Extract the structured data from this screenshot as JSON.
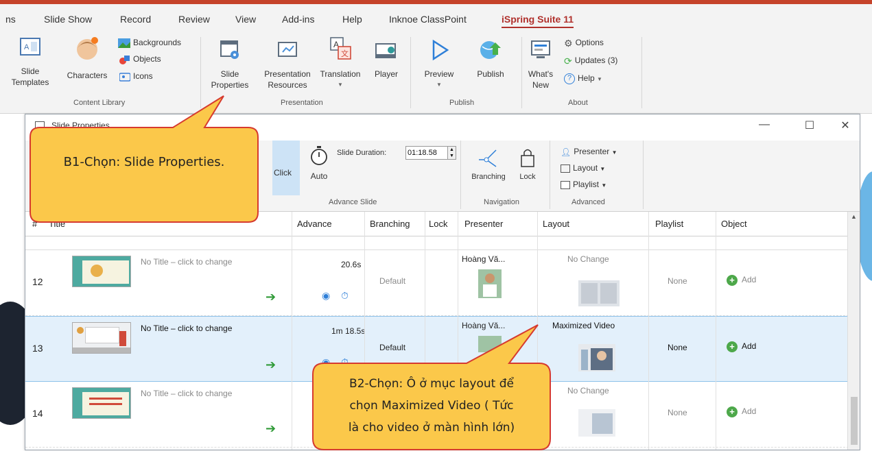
{
  "ribbon_tabs": [
    "ns",
    "Slide Show",
    "Record",
    "Review",
    "View",
    "Add-ins",
    "Help",
    "Inknoe ClassPoint",
    "iSpring Suite 11"
  ],
  "ribbon": {
    "content_library": {
      "label": "Content Library",
      "slide_templates": "Slide\nTemplates",
      "characters": "Characters",
      "backgrounds": "Backgrounds",
      "objects": "Objects",
      "icons": "Icons"
    },
    "presentation": {
      "label": "Presentation",
      "slide_properties_1": "Slide",
      "slide_properties_2": "Properties",
      "presentation_resources_1": "Presentation",
      "presentation_resources_2": "Resources",
      "translation": "Translation",
      "player": "Player"
    },
    "publish": {
      "label": "Publish",
      "preview": "Preview",
      "publish": "Publish"
    },
    "about": {
      "label": "About",
      "whats_new_1": "What's",
      "whats_new_2": "New",
      "options": "Options",
      "updates": "Updates (3)",
      "help": "Help"
    }
  },
  "dialog": {
    "title": "Slide Properties",
    "toolbar": {
      "on_click": "Click",
      "auto": "Auto",
      "slide_duration_label": "Slide Duration:",
      "slide_duration_value": "01:18.58",
      "advance_slide_label": "Advance Slide",
      "branching": "Branching",
      "lock": "Lock",
      "navigation_label": "Navigation",
      "presenter": "Presenter",
      "layout": "Layout",
      "playlist": "Playlist",
      "advanced_label": "Advanced"
    },
    "columns": [
      "#",
      "Title",
      "Advance",
      "Branching",
      "Lock",
      "Presenter",
      "Layout",
      "Playlist",
      "Object"
    ],
    "rows": [
      {
        "num": "12",
        "title": "No Title – click to change",
        "advance": "20.6s",
        "branching": "Default",
        "presenter": "Hoàng Vă...",
        "layout": "No Change",
        "playlist": "None",
        "object": "Add"
      },
      {
        "num": "13",
        "title": "No Title – click to change",
        "advance": "1m 18.5s",
        "branching": "Default",
        "presenter": "Hoàng Vă...",
        "layout": "Maximized Video",
        "playlist": "None",
        "object": "Add"
      },
      {
        "num": "14",
        "title": "No Title – click to change",
        "advance": "",
        "branching": "",
        "presenter": "",
        "layout": "No Change",
        "playlist": "None",
        "object": "Add"
      }
    ]
  },
  "callouts": {
    "step1": "B1-Chọn: Slide Properties.",
    "step2_line1": "B2-Chọn: Ô ở mục layout để",
    "step2_line2": "chọn Maximized Video ( Tức",
    "step2_line3": "là cho video ở màn hình lớn)"
  },
  "colors": {
    "accent_red": "#b0302c",
    "callout_fill": "#fbc84a",
    "callout_border": "#d63a2f",
    "selected_row": "#e3f0fb",
    "green": "#2f9a37"
  }
}
